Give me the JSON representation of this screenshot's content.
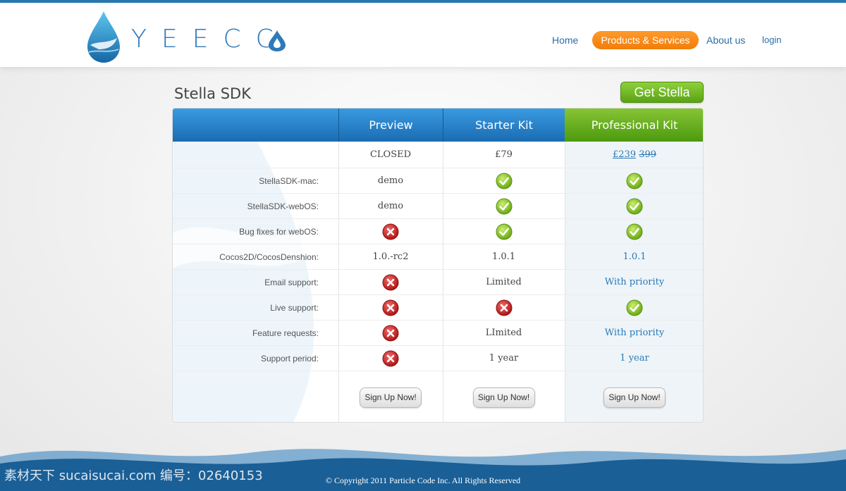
{
  "brand": {
    "name": "YEECC",
    "colors": {
      "blue": "#2a78b0",
      "orange": "#f58512",
      "green": "#5aa315"
    }
  },
  "nav": {
    "items": [
      {
        "label": "Home"
      },
      {
        "label": "Products & Services",
        "active": true
      },
      {
        "label": "About us"
      },
      {
        "label": "login"
      }
    ]
  },
  "page": {
    "title": "Stella SDK",
    "cta_label": "Get Stella"
  },
  "table": {
    "columns": [
      "Preview",
      "Starter Kit",
      "Professional Kit"
    ],
    "price_row": {
      "preview": "CLOSED",
      "starter": "£79",
      "pro_new": "£239",
      "pro_old": "399"
    },
    "rows": [
      {
        "label": "StellaSDK-mac:",
        "preview": "demo",
        "starter": "check-icon",
        "pro": "check-icon"
      },
      {
        "label": "StellaSDK-webOS:",
        "preview": "demo",
        "starter": "check-icon",
        "pro": "check-icon"
      },
      {
        "label": "Bug fixes for webOS:",
        "preview": "cross-icon",
        "starter": "check-icon",
        "pro": "check-icon"
      },
      {
        "label": "Cocos2D/CocosDenshion:",
        "preview": "1.0.-rc2",
        "starter": "1.0.1",
        "pro": "1.0.1"
      },
      {
        "label": "Email support:",
        "preview": "cross-icon",
        "starter": "Limited",
        "pro": "With priority"
      },
      {
        "label": "Live support:",
        "preview": "cross-icon",
        "starter": "cross-icon",
        "pro": "check-icon"
      },
      {
        "label": "Feature requests:",
        "preview": "cross-icon",
        "starter": "LImited",
        "pro": "With priority"
      },
      {
        "label": "Support period:",
        "preview": "cross-icon",
        "starter": "1 year",
        "pro": "1 year"
      }
    ],
    "signup_label": "Sign Up Now!"
  },
  "footer": {
    "copyright": "© Copyright 2011 Particle Code Inc. All Rights Reserved",
    "watermark": "素材天下 sucaisucai.com   编号：02640153"
  }
}
